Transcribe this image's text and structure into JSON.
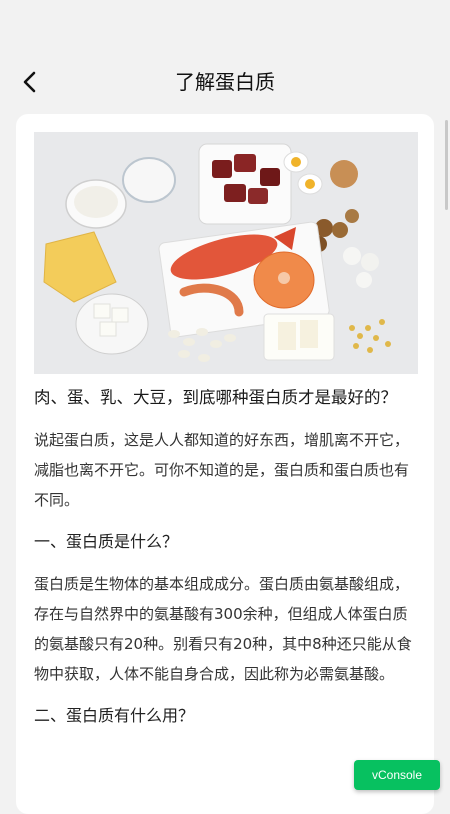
{
  "header": {
    "title": "了解蛋白质",
    "back_icon": "chevron-left-icon"
  },
  "hero": {
    "image_alt": "food-photo"
  },
  "article": {
    "question": "肉、蛋、乳、大豆，到底哪种蛋白质才是最好的？",
    "intro": "说起蛋白质，这是人人都知道的好东西，增肌离不开它，减脂也离不开它。可你不知道的是，蛋白质和蛋白质也有不同。",
    "section1_title": "一、蛋白质是什么？",
    "section1_body": "蛋白质是生物体的基本组成成分。蛋白质由氨基酸组成，存在与自然界中的氨基酸有300余种，但组成人体蛋白质的氨基酸只有20种。别看只有20种，其中8种还只能从食物中获取，人体不能自身合成，因此称为必需氨基酸。",
    "section2_title": "二、蛋白质有什么用？"
  },
  "vconsole": {
    "label": "vConsole"
  },
  "colors": {
    "accent": "#07c160",
    "background": "#f2f2f2",
    "card": "#ffffff"
  }
}
